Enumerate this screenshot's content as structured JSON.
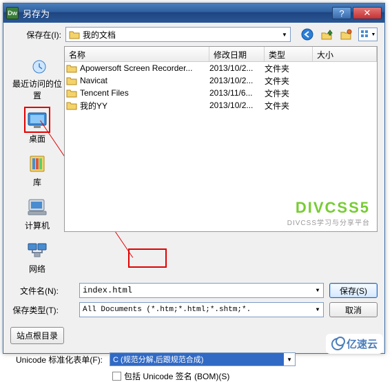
{
  "titlebar": {
    "app_icon_text": "Dw",
    "title": "另存为"
  },
  "savein": {
    "label": "保存在(I):",
    "value": "我的文档"
  },
  "sidebar": {
    "items": [
      {
        "label": "最近访问的位置"
      },
      {
        "label": "桌面"
      },
      {
        "label": "库"
      },
      {
        "label": "计算机"
      },
      {
        "label": "网络"
      }
    ]
  },
  "columns": {
    "name": "名称",
    "date": "修改日期",
    "type": "类型",
    "size": "大小"
  },
  "files": [
    {
      "name": "Apowersoft Screen Recorder...",
      "date": "2013/10/2...",
      "type": "文件夹"
    },
    {
      "name": "Navicat",
      "date": "2013/10/2...",
      "type": "文件夹"
    },
    {
      "name": "Tencent Files",
      "date": "2013/11/6...",
      "type": "文件夹"
    },
    {
      "name": "我的YY",
      "date": "2013/10/2...",
      "type": "文件夹"
    }
  ],
  "watermark": {
    "big": "DIVCSS5",
    "small": "DIVCSS学习与分享平台"
  },
  "filename": {
    "label": "文件名(N):",
    "value": "index.html"
  },
  "filetype": {
    "label": "保存类型(T):",
    "value": "All Documents (*.htm;*.html;*.shtm;*."
  },
  "buttons": {
    "save": "保存(S)",
    "cancel": "取消"
  },
  "siteroot": "站点根目录",
  "unicode": {
    "label": "Unicode 标准化表单(F):",
    "value": "C (规范分解,后跟规范合成)"
  },
  "bom": {
    "label": "包括 Unicode 签名 (BOM)(S)"
  },
  "brand": "亿速云"
}
